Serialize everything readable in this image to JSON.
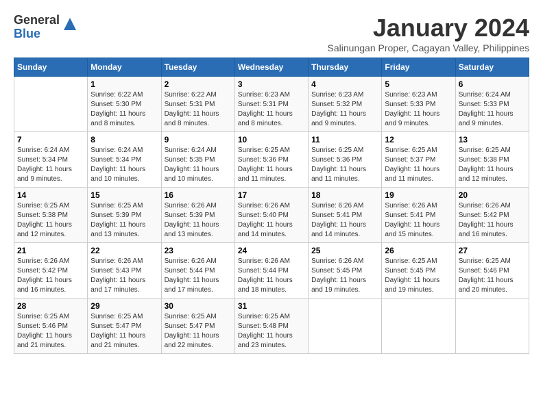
{
  "header": {
    "logo_general": "General",
    "logo_blue": "Blue",
    "month_title": "January 2024",
    "subtitle": "Salinungan Proper, Cagayan Valley, Philippines"
  },
  "days_of_week": [
    "Sunday",
    "Monday",
    "Tuesday",
    "Wednesday",
    "Thursday",
    "Friday",
    "Saturday"
  ],
  "weeks": [
    [
      {
        "day": "",
        "info": ""
      },
      {
        "day": "1",
        "info": "Sunrise: 6:22 AM\nSunset: 5:30 PM\nDaylight: 11 hours\nand 8 minutes."
      },
      {
        "day": "2",
        "info": "Sunrise: 6:22 AM\nSunset: 5:31 PM\nDaylight: 11 hours\nand 8 minutes."
      },
      {
        "day": "3",
        "info": "Sunrise: 6:23 AM\nSunset: 5:31 PM\nDaylight: 11 hours\nand 8 minutes."
      },
      {
        "day": "4",
        "info": "Sunrise: 6:23 AM\nSunset: 5:32 PM\nDaylight: 11 hours\nand 9 minutes."
      },
      {
        "day": "5",
        "info": "Sunrise: 6:23 AM\nSunset: 5:33 PM\nDaylight: 11 hours\nand 9 minutes."
      },
      {
        "day": "6",
        "info": "Sunrise: 6:24 AM\nSunset: 5:33 PM\nDaylight: 11 hours\nand 9 minutes."
      }
    ],
    [
      {
        "day": "7",
        "info": "Sunrise: 6:24 AM\nSunset: 5:34 PM\nDaylight: 11 hours\nand 9 minutes."
      },
      {
        "day": "8",
        "info": "Sunrise: 6:24 AM\nSunset: 5:34 PM\nDaylight: 11 hours\nand 10 minutes."
      },
      {
        "day": "9",
        "info": "Sunrise: 6:24 AM\nSunset: 5:35 PM\nDaylight: 11 hours\nand 10 minutes."
      },
      {
        "day": "10",
        "info": "Sunrise: 6:25 AM\nSunset: 5:36 PM\nDaylight: 11 hours\nand 11 minutes."
      },
      {
        "day": "11",
        "info": "Sunrise: 6:25 AM\nSunset: 5:36 PM\nDaylight: 11 hours\nand 11 minutes."
      },
      {
        "day": "12",
        "info": "Sunrise: 6:25 AM\nSunset: 5:37 PM\nDaylight: 11 hours\nand 11 minutes."
      },
      {
        "day": "13",
        "info": "Sunrise: 6:25 AM\nSunset: 5:38 PM\nDaylight: 11 hours\nand 12 minutes."
      }
    ],
    [
      {
        "day": "14",
        "info": "Sunrise: 6:25 AM\nSunset: 5:38 PM\nDaylight: 11 hours\nand 12 minutes."
      },
      {
        "day": "15",
        "info": "Sunrise: 6:25 AM\nSunset: 5:39 PM\nDaylight: 11 hours\nand 13 minutes."
      },
      {
        "day": "16",
        "info": "Sunrise: 6:26 AM\nSunset: 5:39 PM\nDaylight: 11 hours\nand 13 minutes."
      },
      {
        "day": "17",
        "info": "Sunrise: 6:26 AM\nSunset: 5:40 PM\nDaylight: 11 hours\nand 14 minutes."
      },
      {
        "day": "18",
        "info": "Sunrise: 6:26 AM\nSunset: 5:41 PM\nDaylight: 11 hours\nand 14 minutes."
      },
      {
        "day": "19",
        "info": "Sunrise: 6:26 AM\nSunset: 5:41 PM\nDaylight: 11 hours\nand 15 minutes."
      },
      {
        "day": "20",
        "info": "Sunrise: 6:26 AM\nSunset: 5:42 PM\nDaylight: 11 hours\nand 16 minutes."
      }
    ],
    [
      {
        "day": "21",
        "info": "Sunrise: 6:26 AM\nSunset: 5:42 PM\nDaylight: 11 hours\nand 16 minutes."
      },
      {
        "day": "22",
        "info": "Sunrise: 6:26 AM\nSunset: 5:43 PM\nDaylight: 11 hours\nand 17 minutes."
      },
      {
        "day": "23",
        "info": "Sunrise: 6:26 AM\nSunset: 5:44 PM\nDaylight: 11 hours\nand 17 minutes."
      },
      {
        "day": "24",
        "info": "Sunrise: 6:26 AM\nSunset: 5:44 PM\nDaylight: 11 hours\nand 18 minutes."
      },
      {
        "day": "25",
        "info": "Sunrise: 6:26 AM\nSunset: 5:45 PM\nDaylight: 11 hours\nand 19 minutes."
      },
      {
        "day": "26",
        "info": "Sunrise: 6:25 AM\nSunset: 5:45 PM\nDaylight: 11 hours\nand 19 minutes."
      },
      {
        "day": "27",
        "info": "Sunrise: 6:25 AM\nSunset: 5:46 PM\nDaylight: 11 hours\nand 20 minutes."
      }
    ],
    [
      {
        "day": "28",
        "info": "Sunrise: 6:25 AM\nSunset: 5:46 PM\nDaylight: 11 hours\nand 21 minutes."
      },
      {
        "day": "29",
        "info": "Sunrise: 6:25 AM\nSunset: 5:47 PM\nDaylight: 11 hours\nand 21 minutes."
      },
      {
        "day": "30",
        "info": "Sunrise: 6:25 AM\nSunset: 5:47 PM\nDaylight: 11 hours\nand 22 minutes."
      },
      {
        "day": "31",
        "info": "Sunrise: 6:25 AM\nSunset: 5:48 PM\nDaylight: 11 hours\nand 23 minutes."
      },
      {
        "day": "",
        "info": ""
      },
      {
        "day": "",
        "info": ""
      },
      {
        "day": "",
        "info": ""
      }
    ]
  ]
}
